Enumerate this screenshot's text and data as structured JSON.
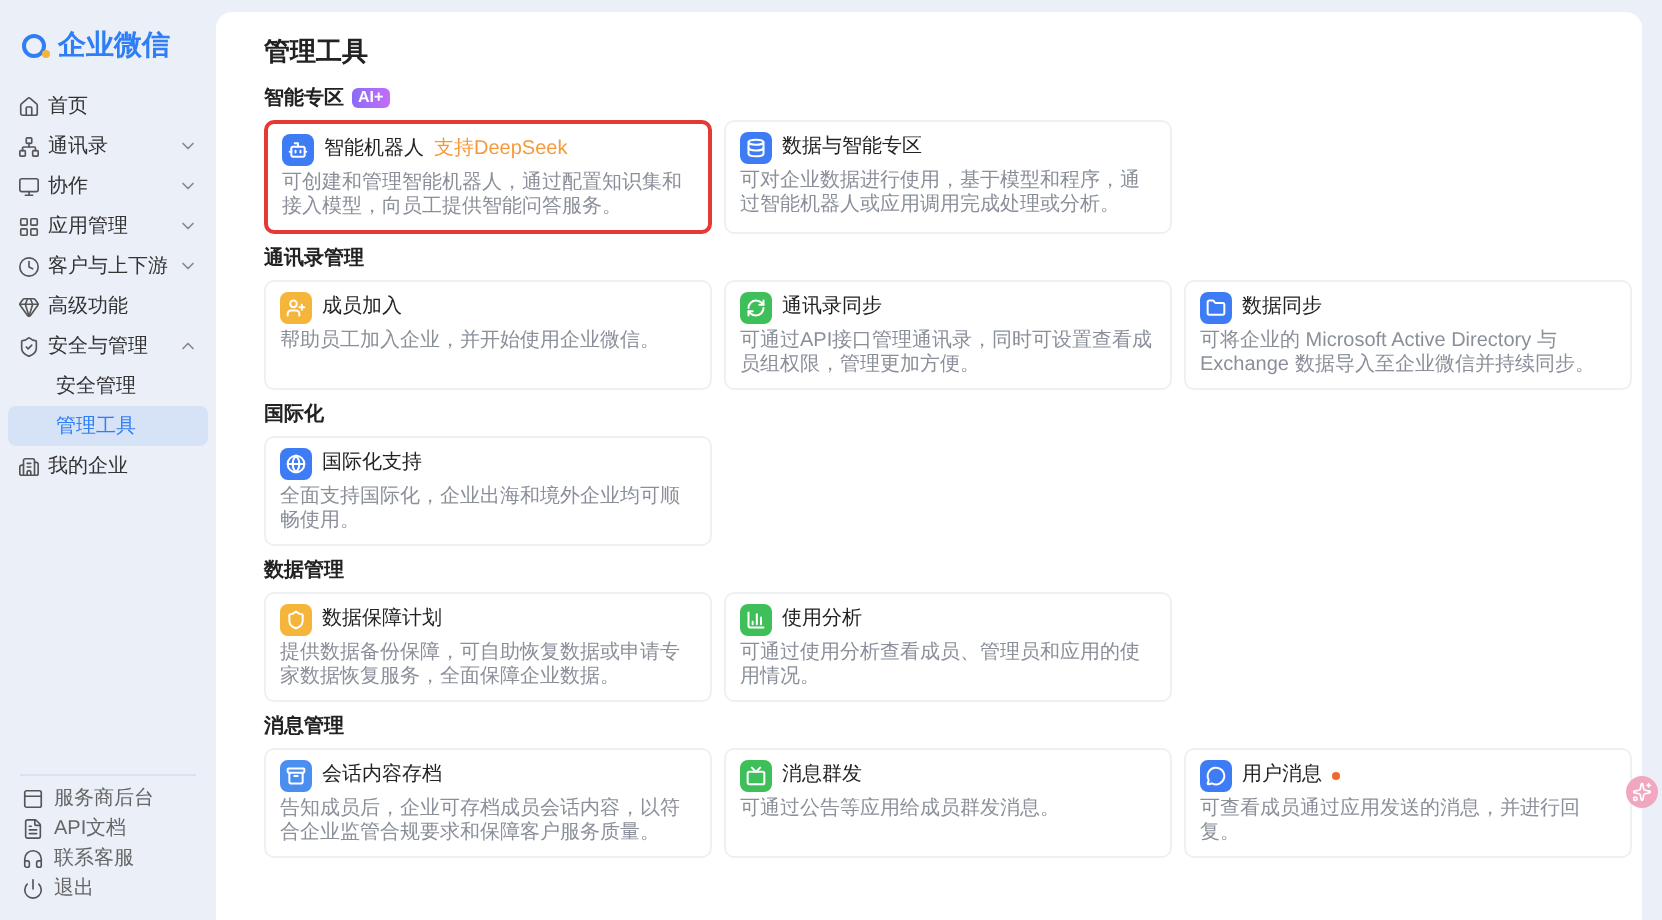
{
  "logo": {
    "text": "企业微信"
  },
  "sidebar": {
    "items": [
      {
        "label": "首页",
        "selected": false
      },
      {
        "label": "通讯录",
        "selected": false,
        "expanded": false
      },
      {
        "label": "协作",
        "selected": false,
        "expanded": false
      },
      {
        "label": "应用管理",
        "selected": false,
        "expanded": false
      },
      {
        "label": "客户与上下游",
        "selected": false,
        "expanded": false
      },
      {
        "label": "高级功能",
        "selected": false
      },
      {
        "label": "安全与管理",
        "selected": false,
        "expanded": true,
        "children": [
          {
            "label": "安全管理",
            "selected": false
          },
          {
            "label": "管理工具",
            "selected": true
          }
        ]
      },
      {
        "label": "我的企业",
        "selected": false
      }
    ],
    "footer_links": [
      {
        "label": "服务商后台"
      },
      {
        "label": "API文档"
      },
      {
        "label": "联系客服"
      },
      {
        "label": "退出"
      }
    ]
  },
  "page_title": "管理工具",
  "sections": [
    {
      "title": "智能专区",
      "badge": "AI+",
      "cards": [
        {
          "title": "智能机器人",
          "color": "#3d7cf5",
          "tag": "支持DeepSeek",
          "highlighted": true,
          "description": "可创建和管理智能机器人，通过配置知识集和接入模型，向员工提供智能问答服务。"
        },
        {
          "title": "数据与智能专区",
          "color": "#3d7cf5",
          "highlighted": false,
          "description": "可对企业数据进行使用，基于模型和程序，通过智能机器人或应用调用完成处理或分析。"
        }
      ]
    },
    {
      "title": "通讯录管理",
      "cards": [
        {
          "title": "成员加入",
          "color": "#f5b43a",
          "highlighted": false,
          "description": "帮助员工加入企业，并开始使用企业微信。"
        },
        {
          "title": "通讯录同步",
          "color": "#3fbf5a",
          "highlighted": false,
          "description": "可通过API接口管理通讯录，同时可设置查看成员组权限，管理更加方便。"
        },
        {
          "title": "数据同步",
          "color": "#3d7cf5",
          "highlighted": false,
          "description": "可将企业的 Microsoft Active Directory 与 Exchange 数据导入至企业微信并持续同步。"
        }
      ]
    },
    {
      "title": "国际化",
      "cards": [
        {
          "title": "国际化支持",
          "color": "#3d7cf5",
          "highlighted": false,
          "description": "全面支持国际化，企业出海和境外企业均可顺畅使用。"
        }
      ]
    },
    {
      "title": "数据管理",
      "cards": [
        {
          "title": "数据保障计划",
          "color": "#f5b43a",
          "highlighted": false,
          "description": "提供数据备份保障，可自助恢复数据或申请专家数据恢复服务，全面保障企业数据。"
        },
        {
          "title": "使用分析",
          "color": "#3fbf5a",
          "highlighted": false,
          "description": "可通过使用分析查看成员、管理员和应用的使用情况。"
        }
      ]
    },
    {
      "title": "消息管理",
      "cards": [
        {
          "title": "会话内容存档",
          "color": "#4a8ef0",
          "highlighted": false,
          "description": "告知成员后，企业可存档成员会话内容，以符合企业监管合规要求和保障客户服务质量。"
        },
        {
          "title": "消息群发",
          "color": "#3fbf5a",
          "highlighted": false,
          "description": "可通过公告等应用给成员群发消息。"
        },
        {
          "title": "用户消息",
          "color": "#3d7cf5",
          "highlighted": false,
          "new_dot": true,
          "description": "可查看成员通过应用发送的消息，并进行回复。"
        }
      ]
    }
  ]
}
